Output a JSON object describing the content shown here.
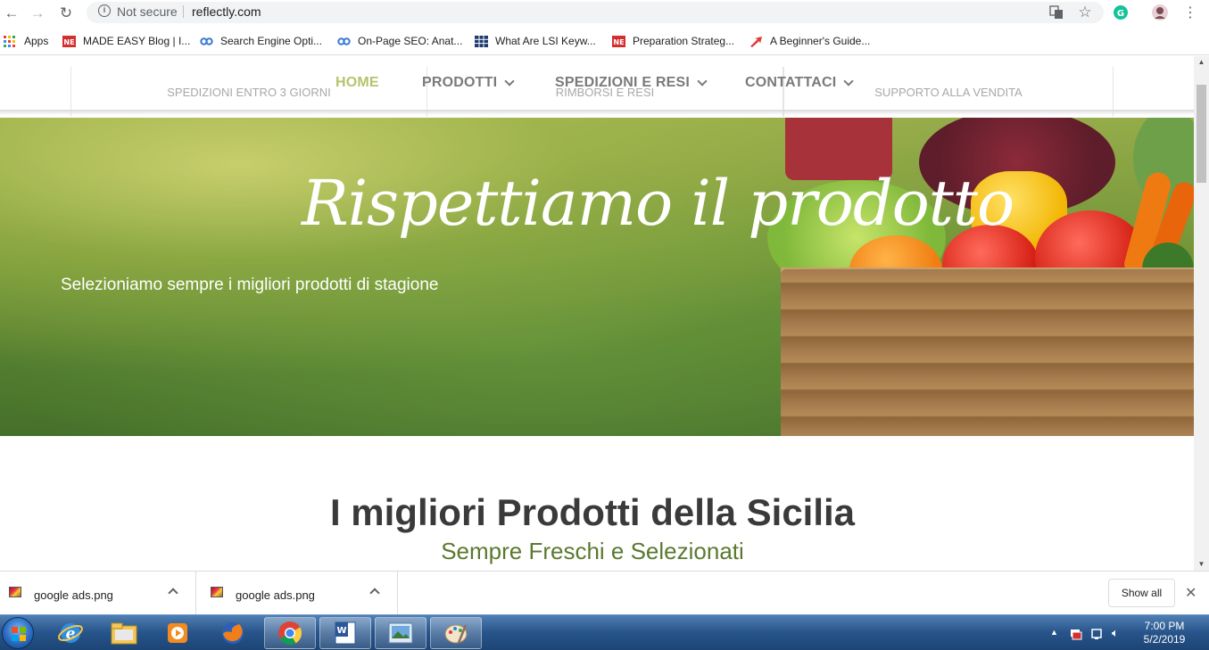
{
  "browser": {
    "security_label": "Not secure",
    "url": "reflectly.com"
  },
  "bookmarks": [
    {
      "label": "Apps",
      "icon": "apps-grid-icon"
    },
    {
      "label": "MADE EASY Blog | I...",
      "icon": "made-easy-icon"
    },
    {
      "label": "Search Engine Opti...",
      "icon": "link-icon"
    },
    {
      "label": "On-Page SEO: Anat...",
      "icon": "link-icon"
    },
    {
      "label": "What Are LSI Keyw...",
      "icon": "grid-icon"
    },
    {
      "label": "Preparation Strateg...",
      "icon": "made-easy-icon"
    },
    {
      "label": "A Beginner's Guide...",
      "icon": "arrow-icon"
    }
  ],
  "topbar": {
    "left": "SPEDIZIONI ENTRO 3 GIORNI",
    "middle": "RIMBORSI E RESI",
    "right": "SUPPORTO ALLA VENDITA"
  },
  "menu": {
    "home": "HOME",
    "prodotti": "PRODOTTI",
    "spedizioni": "SPEDIZIONI E RESI",
    "contattaci": "CONTATTACI"
  },
  "hero": {
    "title": "Rispettiamo il prodotto",
    "subtitle": "Selezioniamo sempre i migliori prodotti di stagione"
  },
  "section": {
    "title": "I migliori Prodotti della Sicilia",
    "subtitle": "Sempre Freschi e Selezionati"
  },
  "downloads": {
    "items": [
      {
        "name": "google ads.png"
      },
      {
        "name": "google ads.png"
      }
    ],
    "show_all": "Show all"
  },
  "taskbar": {
    "time": "7:00 PM",
    "date": "5/2/2019"
  },
  "colors": {
    "menu_active": "#b5c46b",
    "section_subtitle": "#5b7a2f"
  }
}
